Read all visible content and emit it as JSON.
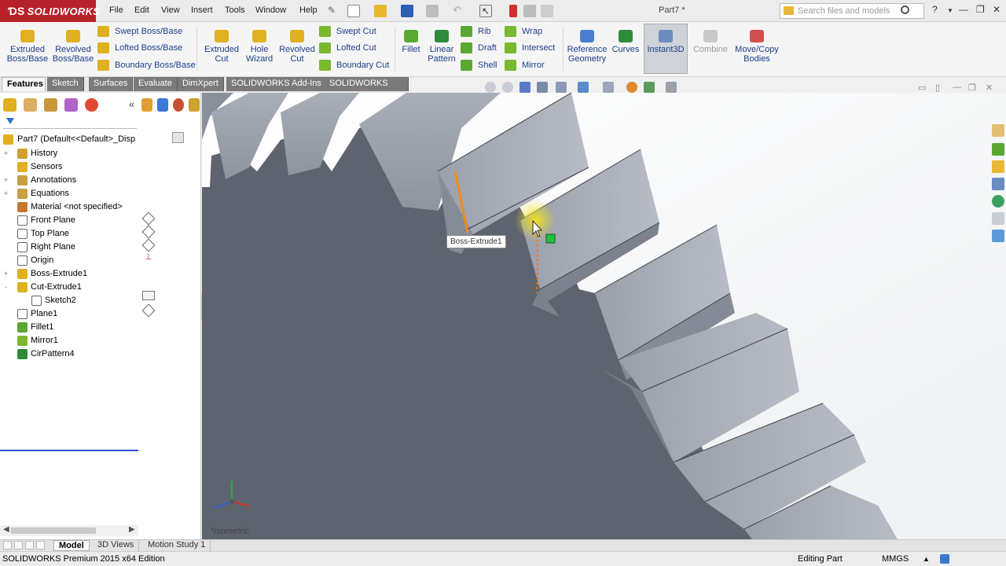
{
  "app": {
    "logo_text": "SOLIDWORKS",
    "document_title": "Part7 *"
  },
  "menu": [
    "File",
    "Edit",
    "View",
    "Insert",
    "Tools",
    "Window",
    "Help"
  ],
  "search": {
    "placeholder": "Search files and models"
  },
  "command_manager": {
    "big_buttons": [
      {
        "label1": "Extruded",
        "label2": "Boss/Base",
        "color": "#e0b020"
      },
      {
        "label1": "Revolved",
        "label2": "Boss/Base",
        "color": "#e0b020"
      },
      {
        "label1": "Extruded",
        "label2": "Cut",
        "color": "#e0b020"
      },
      {
        "label1": "Hole",
        "label2": "Wizard",
        "color": "#e0b020"
      },
      {
        "label1": "Revolved",
        "label2": "Cut",
        "color": "#e0b020"
      },
      {
        "label1": "Fillet",
        "label2": "",
        "color": "#5aa832"
      },
      {
        "label1": "Linear",
        "label2": "Pattern",
        "color": "#2e8b3a"
      },
      {
        "label1": "Reference",
        "label2": "Geometry",
        "color": "#4a7fd0"
      },
      {
        "label1": "Curves",
        "label2": "",
        "color": "#2e8b3a"
      },
      {
        "label1": "Instant3D",
        "label2": "",
        "color": "#6a8cc0"
      },
      {
        "label1": "Combine",
        "label2": "",
        "color": "#b0b0b0"
      },
      {
        "label1": "Move/Copy",
        "label2": "Bodies",
        "color": "#d05050"
      }
    ],
    "small_buttons": [
      {
        "label": "Swept Boss/Base",
        "color": "#e0b020"
      },
      {
        "label": "Lofted Boss/Base",
        "color": "#e0b020"
      },
      {
        "label": "Boundary Boss/Base",
        "color": "#e0b020"
      },
      {
        "label": "Swept Cut",
        "color": "#7ab830"
      },
      {
        "label": "Lofted Cut",
        "color": "#7ab830"
      },
      {
        "label": "Boundary Cut",
        "color": "#7ab830"
      },
      {
        "label": "Rib",
        "color": "#5aa832"
      },
      {
        "label": "Draft",
        "color": "#5aa832"
      },
      {
        "label": "Shell",
        "color": "#5aa832"
      },
      {
        "label": "Wrap",
        "color": "#7ab830"
      },
      {
        "label": "Intersect",
        "color": "#7ab830"
      },
      {
        "label": "Mirror",
        "color": "#7ab830"
      }
    ]
  },
  "tabs": [
    "Features",
    "Sketch",
    "Surfaces",
    "Evaluate",
    "DimXpert",
    "SOLIDWORKS Add-Ins",
    "SOLIDWORKS MBD"
  ],
  "feature_tree": {
    "root": "Part7  (Default<<Default>_Disp",
    "items": [
      {
        "label": "History",
        "icon": "history-icon",
        "color": "#d2a030",
        "expand": "+"
      },
      {
        "label": "Sensors",
        "icon": "sensors-icon",
        "color": "#e0b020",
        "expand": ""
      },
      {
        "label": "Annotations",
        "icon": "annotations-icon",
        "color": "#c8a040",
        "expand": "+"
      },
      {
        "label": "Equations",
        "icon": "equations-icon",
        "color": "#c8a040",
        "expand": "+"
      },
      {
        "label": "Material <not specified>",
        "icon": "material-icon",
        "color": "#c87830",
        "expand": ""
      },
      {
        "label": "Front Plane",
        "icon": "plane-icon",
        "color": "#ffffff",
        "expand": ""
      },
      {
        "label": "Top Plane",
        "icon": "plane-icon",
        "color": "#ffffff",
        "expand": ""
      },
      {
        "label": "Right Plane",
        "icon": "plane-icon",
        "color": "#ffffff",
        "expand": ""
      },
      {
        "label": "Origin",
        "icon": "origin-icon",
        "color": "#ffffff",
        "expand": ""
      },
      {
        "label": "Boss-Extrude1",
        "icon": "extrude-icon",
        "color": "#e0b020",
        "expand": "+"
      },
      {
        "label": "Cut-Extrude1",
        "icon": "cut-extrude-icon",
        "color": "#e0b020",
        "expand": "-"
      },
      {
        "label": "Sketch2",
        "icon": "sketch-icon",
        "color": "#ffffff",
        "expand": "",
        "indent": true
      },
      {
        "label": "Plane1",
        "icon": "plane-icon",
        "color": "#ffffff",
        "expand": ""
      },
      {
        "label": "Fillet1",
        "icon": "fillet-icon",
        "color": "#5aa832",
        "expand": ""
      },
      {
        "label": "Mirror1",
        "icon": "mirror-icon",
        "color": "#7ab830",
        "expand": ""
      },
      {
        "label": "CirPattern4",
        "icon": "cirpattern-icon",
        "color": "#2e8b3a",
        "expand": ""
      }
    ]
  },
  "viewport": {
    "tooltip": "Boss-Extrude1",
    "view_label": "*Isometric",
    "model_color": "#5e646f"
  },
  "bottom_tabs": [
    "Model",
    "3D Views",
    "Motion Study 1"
  ],
  "status": {
    "left": "SOLIDWORKS Premium 2015 x64 Edition",
    "mode": "Editing Part",
    "units": "MMGS",
    "arrow": "▲"
  }
}
